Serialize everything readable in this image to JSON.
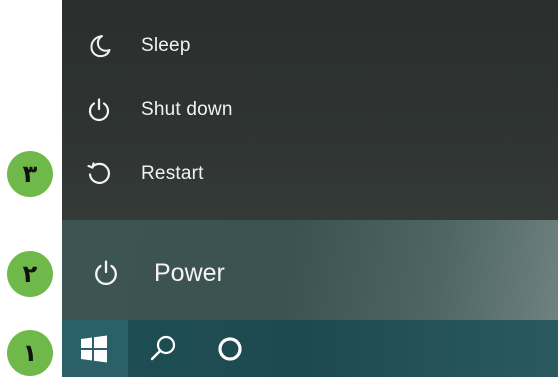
{
  "power_menu": {
    "items": [
      {
        "label": "Sleep",
        "icon": "moon-icon"
      },
      {
        "label": "Shut down",
        "icon": "power-icon"
      },
      {
        "label": "Restart",
        "icon": "restart-icon"
      }
    ]
  },
  "start_menu": {
    "power_label": "Power",
    "power_icon": "power-icon"
  },
  "taskbar": {
    "start_icon": "windows-logo-icon",
    "search_icon": "search-icon",
    "cortana_icon": "cortana-circle-icon"
  },
  "badges": [
    "۳",
    "۲",
    "۱"
  ],
  "colors": {
    "menu_bg": "#2f3433",
    "start_area_bg": "#3d5452",
    "taskbar_bg": "#1f4e55",
    "badge_green": "#6fb94a",
    "text": "#f2f2f2"
  }
}
